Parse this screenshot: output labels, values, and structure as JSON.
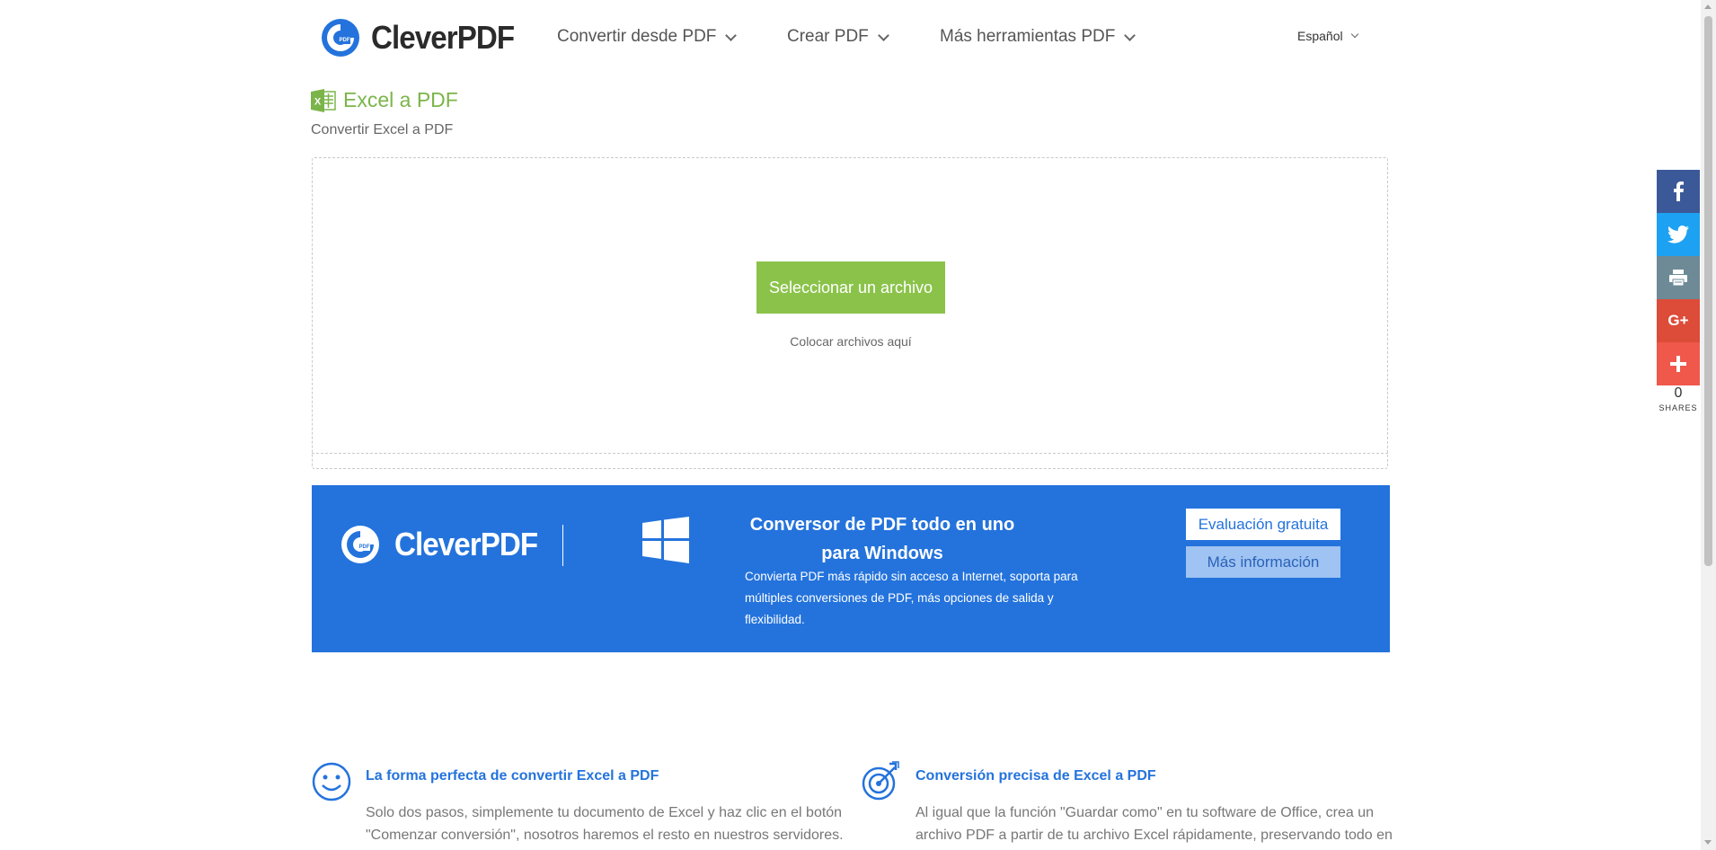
{
  "header": {
    "logo_text": "CleverPDF",
    "nav": [
      {
        "label": "Convertir desde PDF"
      },
      {
        "label": "Crear PDF"
      },
      {
        "label": "Más herramientas PDF"
      }
    ],
    "language": "Español"
  },
  "tool": {
    "title": "Excel a PDF",
    "subtitle": "Convertir Excel a PDF"
  },
  "upload": {
    "button_label": "Seleccionar un archivo",
    "drop_hint": "Colocar archivos aquí"
  },
  "banner": {
    "logo_text": "CleverPDF",
    "heading": "Conversor de PDF todo en uno para Windows",
    "description": "Convierta PDF más rápido sin acceso a Internet, soporta para múltiples conversiones de PDF, más opciones de salida y flexibilidad.",
    "trial_label": "Evaluación gratuita",
    "info_label": "Más información"
  },
  "features": [
    {
      "icon": "smiley-icon",
      "title": "La forma perfecta de convertir Excel a PDF",
      "text": "Solo dos pasos, simplemente tu documento de Excel y haz clic en el botón \"Comenzar conversión\", nosotros haremos el resto en nuestros servidores."
    },
    {
      "icon": "target-icon",
      "title": "Conversión precisa de Excel a PDF",
      "text": "Al igual que la función \"Guardar como\" en tu software de Office, crea un archivo PDF a partir de tu archivo Excel rápidamente, preservando todo en"
    }
  ],
  "share": {
    "count": "0",
    "label": "SHARES",
    "colors": {
      "facebook": "#3b5998",
      "twitter": "#1da1f2",
      "print": "#6d8a96",
      "google": "#dd4b39",
      "more": "#f0584c"
    }
  },
  "colors": {
    "accent_green": "#8bc34a",
    "brand_blue": "#2473dc"
  }
}
